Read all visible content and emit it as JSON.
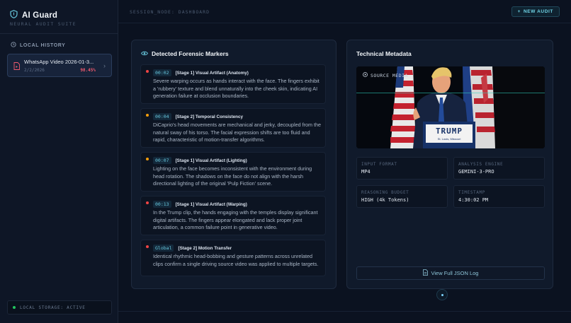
{
  "brand": {
    "name": "AI Guard",
    "subtitle": "NEURAL AUDIT SUITE"
  },
  "sidebar": {
    "history_label": "LOCAL HISTORY",
    "history": [
      {
        "title": "WhatsApp Video 2026-01-3...",
        "date": "2/2/2026",
        "score": "98.45%"
      }
    ],
    "storage_label": "LOCAL STORAGE: ACTIVE"
  },
  "header": {
    "session": "SESSION_NODE: DASHBOARD",
    "new_audit": "NEW AUDIT"
  },
  "forensics": {
    "title": "Detected Forensic Markers",
    "markers": [
      {
        "time": "00:02",
        "label": "[Stage 1] Visual Artifact (Anatomy)",
        "text": "Severe warping occurs as hands interact with the face. The fingers exhibit a 'rubbery' texture and blend unnaturally into the cheek skin, indicating AI generation failure at occlusion boundaries.",
        "severity_color": "#ef4444"
      },
      {
        "time": "00:04",
        "label": "[Stage 2] Temporal Consistency",
        "text": "DiCaprio's head movements are mechanical and jerky, decoupled from the natural sway of his torso. The facial expression shifts are too fluid and rapid, characteristic of motion-transfer algorithms.",
        "severity_color": "#f59e0b"
      },
      {
        "time": "00:07",
        "label": "[Stage 1] Visual Artifact (Lighting)",
        "text": "Lighting on the face becomes inconsistent with the environment during head rotation. The shadows on the face do not align with the harsh directional lighting of the original 'Pulp Fiction' scene.",
        "severity_color": "#f59e0b"
      },
      {
        "time": "00:13",
        "label": "[Stage 1] Visual Artifact (Warping)",
        "text": "In the Trump clip, the hands engaging with the temples display significant digital artifacts. The fingers appear elongated and lack proper joint articulation, a common failure point in generative video.",
        "severity_color": "#ef4444"
      },
      {
        "time": "Global",
        "label": "[Stage 2] Motion Transfer",
        "text": "Identical rhythmic head-bobbing and gesture patterns across unrelated clips confirm a single driving source video was applied to multiple targets.",
        "severity_color": "#ef4444"
      }
    ]
  },
  "metadata": {
    "title": "Technical Metadata",
    "video_label": "SOURCE MEDIA",
    "podium_text": "TRUMP",
    "podium_sub": "St. Louis, Missouri",
    "fields": [
      {
        "key": "INPUT FORMAT",
        "value": "MP4"
      },
      {
        "key": "ANALYSIS ENGINE",
        "value": "GEMINI-3-PRO"
      },
      {
        "key": "REASONING BUDGET",
        "value": "HIGH (4k Tokens)"
      },
      {
        "key": "TIMESTAMP",
        "value": "4:30:02 PM"
      }
    ],
    "json_button": "View Full JSON Log"
  },
  "colors": {
    "accent": "#67c6dc",
    "danger": "#ef4444",
    "warning": "#f59e0b",
    "ok": "#22c55e"
  }
}
